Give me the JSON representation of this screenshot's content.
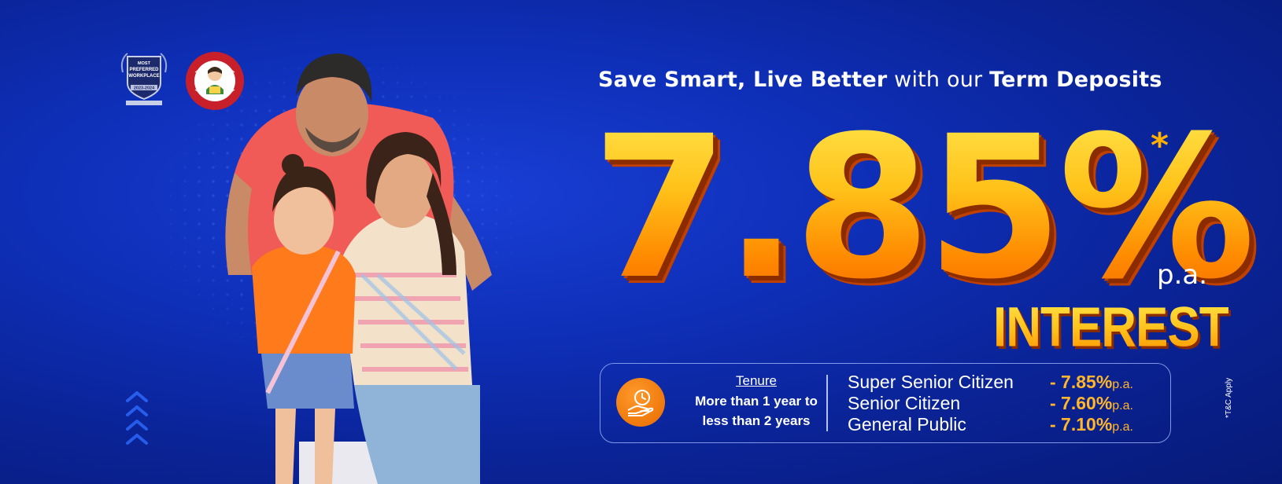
{
  "headline": {
    "part1": "Save Smart, Live Better",
    "part2": " with our ",
    "part3": "Term Deposits"
  },
  "offer": {
    "rate": "7.85",
    "percent_sign": "%",
    "asterisk": "*",
    "per_annum": "p.a.",
    "label": "INTEREST"
  },
  "tenure": {
    "title": "Tenure",
    "line1": "More than 1 year to",
    "line2": "less than 2 years"
  },
  "rates": [
    {
      "category": "Super Senior Citizen",
      "value": "- 7.85%",
      "unit": "p.a."
    },
    {
      "category": "Senior Citizen",
      "value": "- 7.60%",
      "unit": "p.a."
    },
    {
      "category": "General Public",
      "value": "- 7.10%",
      "unit": "p.a."
    }
  ],
  "disclaimer": "*T&C Apply",
  "badges": {
    "workplace": {
      "line1": "MOST",
      "line2": "PREFERRED",
      "line3": "WORKPLACE",
      "years": "2023-2024"
    },
    "bbbp": "beti bachao beti padhao logo"
  },
  "colors": {
    "background": "#0e2fb8",
    "accent_orange": "#ff9a00",
    "rate_orange": "#ffb62a",
    "text": "#ffffff"
  },
  "icons": [
    "chevron-up-icon",
    "clock-hand-icon",
    "workplace-badge-icon",
    "bbbp-logo-icon"
  ]
}
